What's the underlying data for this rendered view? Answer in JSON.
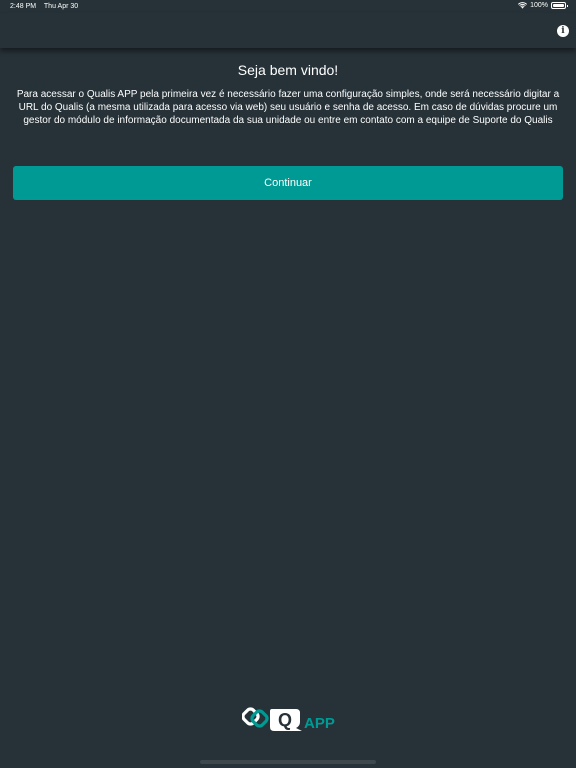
{
  "status_bar": {
    "time": "2:48 PM",
    "date": "Thu Apr 30",
    "battery": "100%"
  },
  "nav": {
    "info_icon": "info-icon",
    "info_glyph": "i"
  },
  "welcome": {
    "title": "Seja bem vindo!",
    "body": "Para acessar o Qualis APP pela primeira vez é necessário fazer uma configuração simples, onde será necessário digitar a URL do Qualis (a mesma utilizada para acesso via web) seu usuário e senha de acesso. Em caso de dúvidas procure um gestor do módulo de informação documentada da sua unidade ou entre em contato com a equipe de Suporte do Qualis"
  },
  "continue_label": "Continuar",
  "logo": {
    "q_letter": "Q",
    "app_text": "APP"
  },
  "colors": {
    "background": "#263238",
    "accent": "#009a94",
    "text": "#ffffff"
  }
}
